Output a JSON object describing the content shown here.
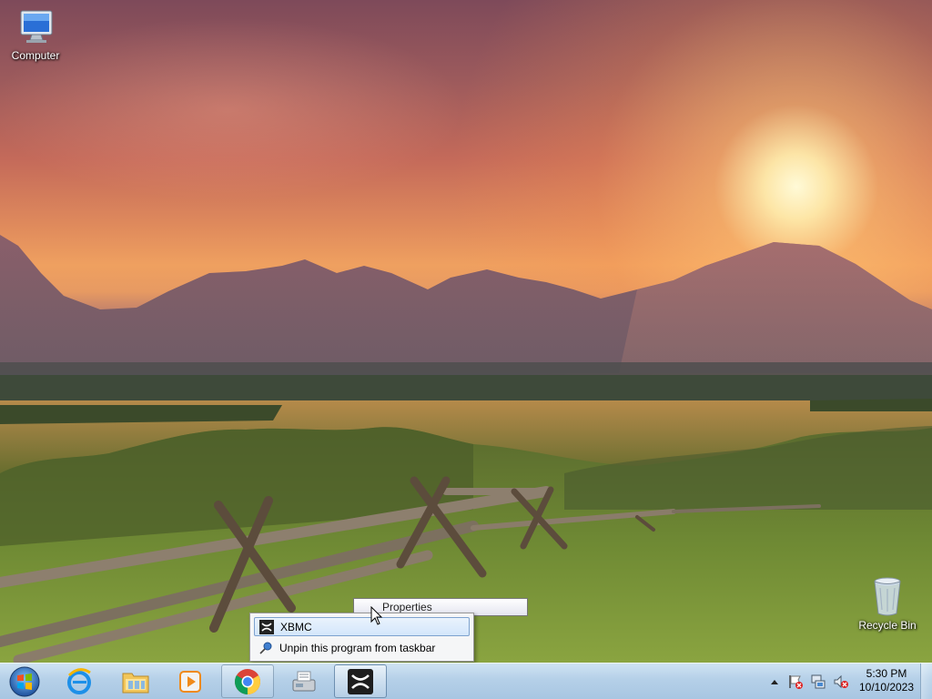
{
  "desktop": {
    "icons": [
      {
        "label": "Computer",
        "icon": "computer-icon"
      },
      {
        "label": "Recycle Bin",
        "icon": "recycle-bin-icon"
      }
    ]
  },
  "tooltip": {
    "label": "Properties"
  },
  "jumplist": {
    "items": [
      {
        "label": "XBMC",
        "icon": "xbmc-icon"
      },
      {
        "label": "Unpin this program from taskbar",
        "icon": "unpin-icon"
      }
    ]
  },
  "taskbar": {
    "start": {
      "icon": "windows-start-orb-icon"
    },
    "buttons": [
      {
        "icon": "internet-explorer-icon",
        "state": "pinned"
      },
      {
        "icon": "file-explorer-icon",
        "state": "pinned"
      },
      {
        "icon": "media-player-icon",
        "state": "pinned"
      },
      {
        "icon": "chrome-icon",
        "state": "running"
      },
      {
        "icon": "fax-printer-icon",
        "state": "pinned"
      },
      {
        "icon": "xbmc-icon",
        "state": "active"
      }
    ],
    "tray": {
      "icons": [
        "show-hidden-icons-chevron",
        "action-center-flag-icon",
        "network-icon",
        "volume-muted-icon"
      ],
      "time": "5:30 PM",
      "date": "10/10/2023"
    }
  },
  "colors": {
    "taskbar": "#b5d0e8",
    "menu_highlight": "#d3e6fb",
    "sun": "#fff5d0"
  }
}
